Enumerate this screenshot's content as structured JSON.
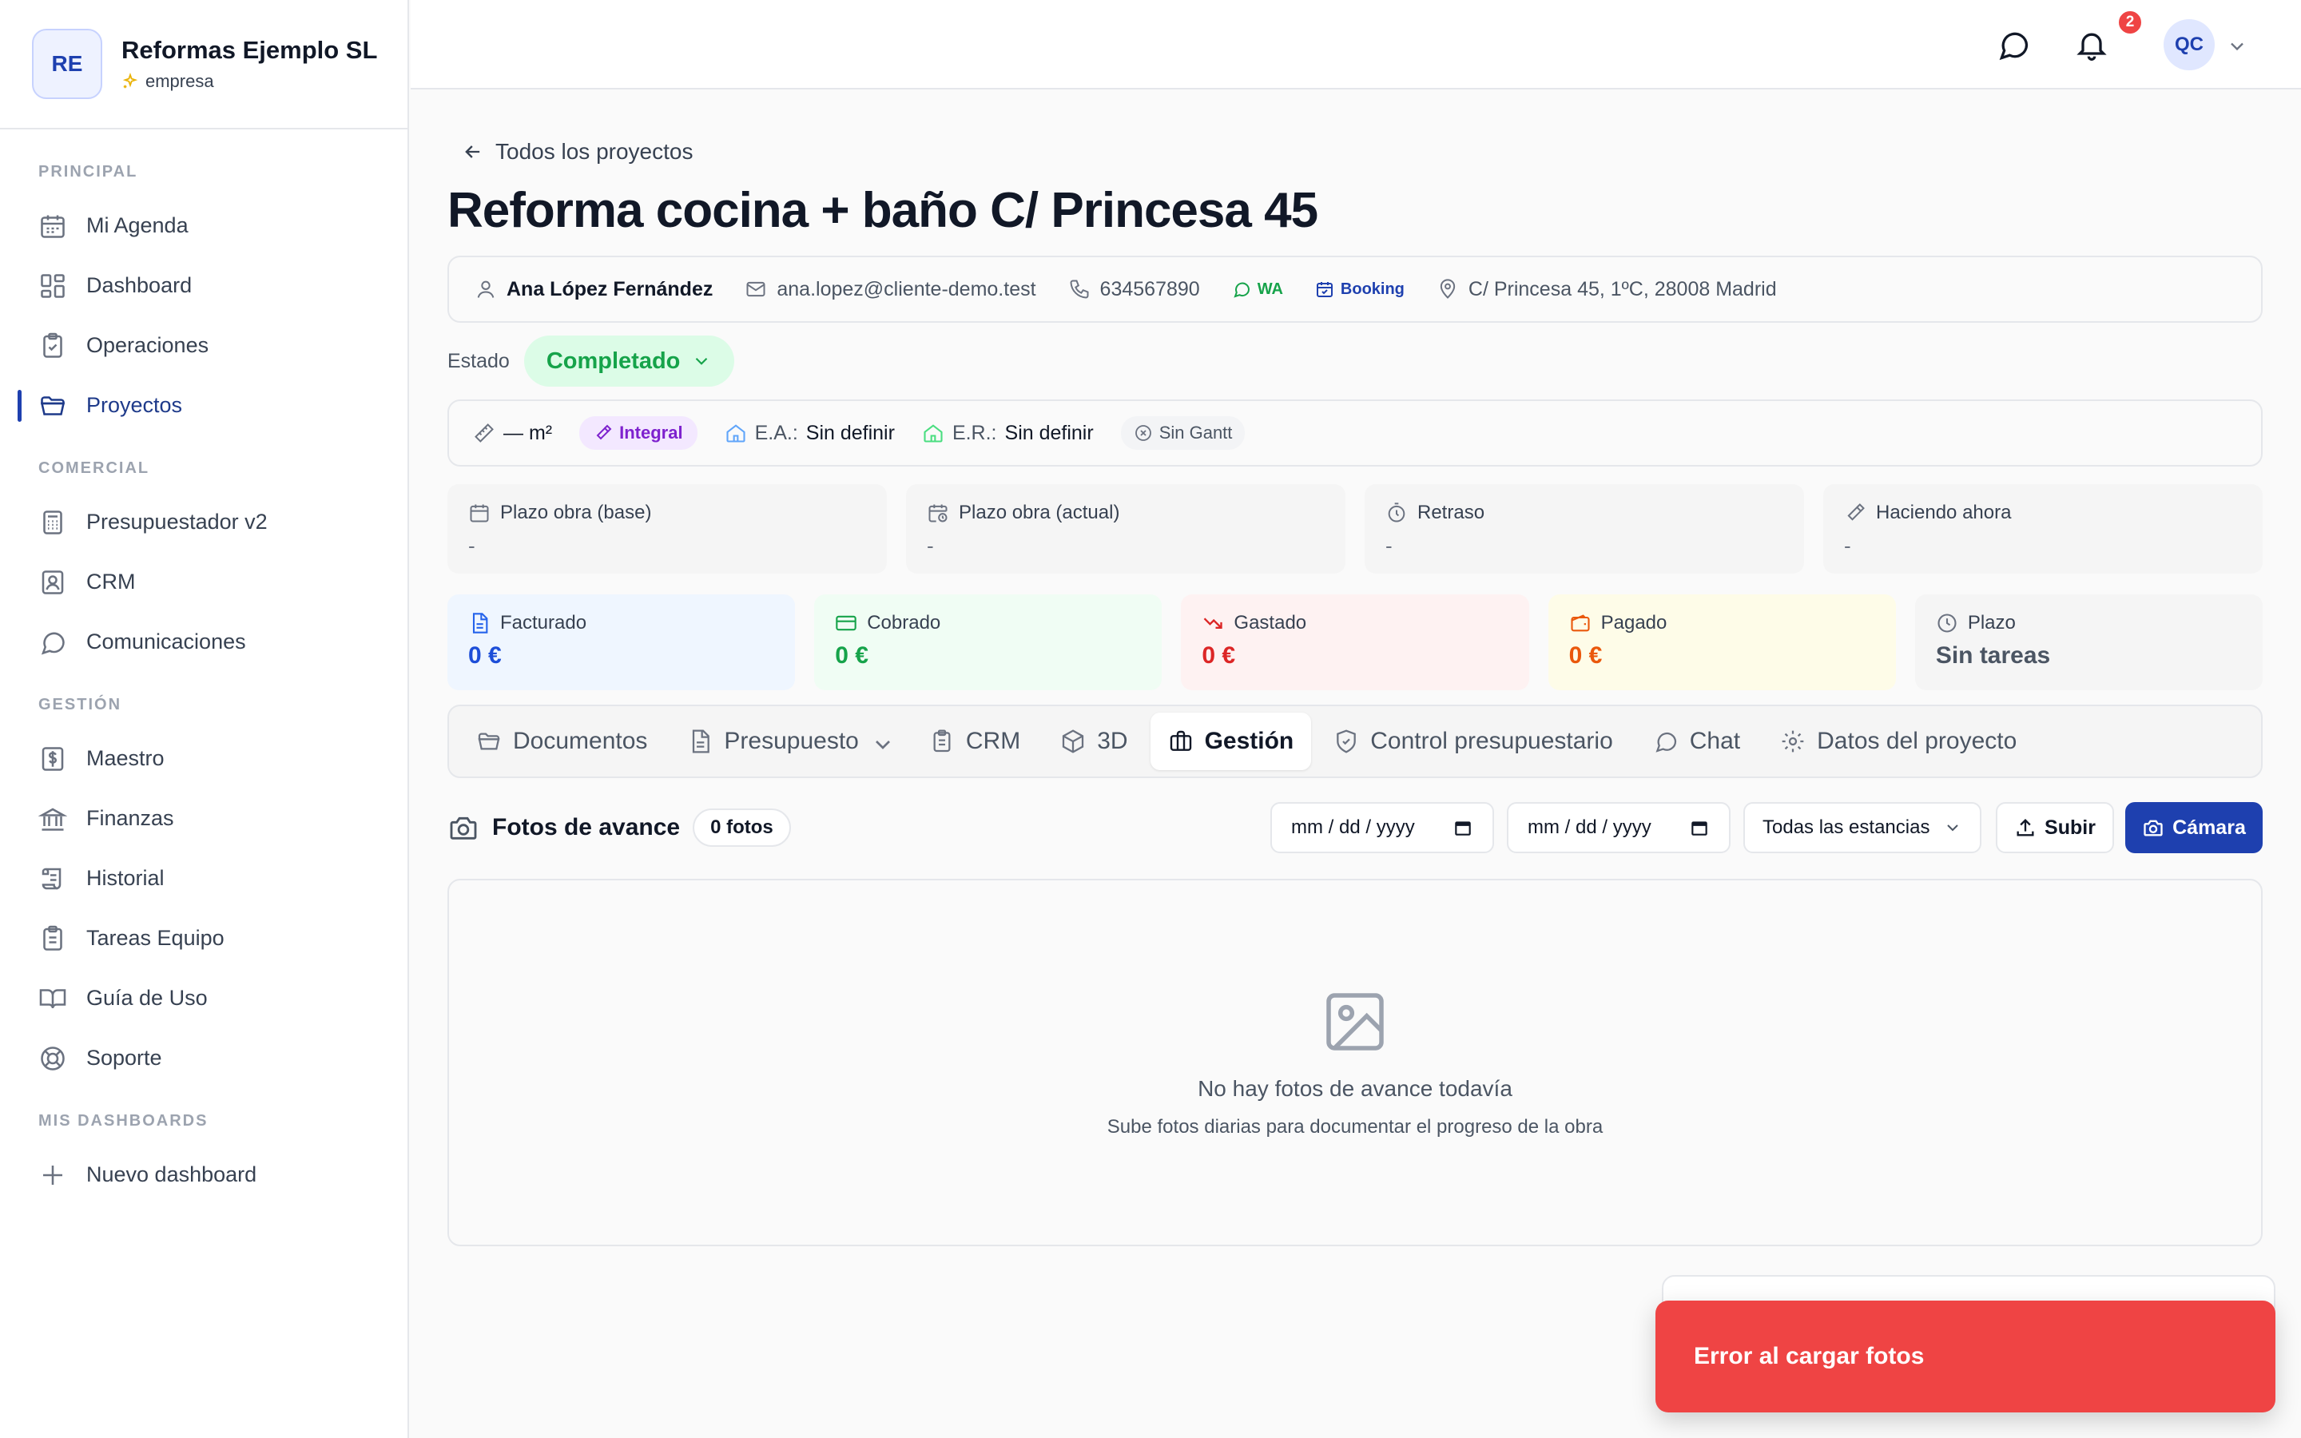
{
  "brand": {
    "initials": "RE",
    "name": "Reformas Ejemplo SL",
    "plan": "empresa"
  },
  "sidebar": {
    "sections": [
      {
        "title": "PRINCIPAL",
        "items": [
          {
            "label": "Mi Agenda",
            "icon": "calendar-icon"
          },
          {
            "label": "Dashboard",
            "icon": "dashboard-icon"
          },
          {
            "label": "Operaciones",
            "icon": "clipboard-icon"
          },
          {
            "label": "Proyectos",
            "icon": "folder-icon",
            "active": true
          }
        ]
      },
      {
        "title": "COMERCIAL",
        "items": [
          {
            "label": "Presupuestador v2",
            "icon": "calculator-icon"
          },
          {
            "label": "CRM",
            "icon": "contact-icon"
          },
          {
            "label": "Comunicaciones",
            "icon": "chat-icon"
          }
        ]
      },
      {
        "title": "GESTIÓN",
        "items": [
          {
            "label": "Maestro",
            "icon": "dollar-icon"
          },
          {
            "label": "Finanzas",
            "icon": "bank-icon"
          },
          {
            "label": "Historial",
            "icon": "scroll-icon"
          },
          {
            "label": "Tareas Equipo",
            "icon": "clipboard-list-icon"
          },
          {
            "label": "Guía de Uso",
            "icon": "book-icon"
          },
          {
            "label": "Soporte",
            "icon": "lifebuoy-icon"
          }
        ]
      },
      {
        "title": "MIS DASHBOARDS",
        "items": [
          {
            "label": "Nuevo dashboard",
            "icon": "plus-icon"
          }
        ]
      }
    ]
  },
  "header": {
    "notifications_count": "2",
    "user_initials": "QC"
  },
  "project": {
    "back_label": "Todos los proyectos",
    "title": "Reforma cocina + baño C/ Princesa 45",
    "client_name": "Ana López Fernández",
    "email": "ana.lopez@cliente-demo.test",
    "phone": "634567890",
    "wa": "WA",
    "booking": "Booking",
    "address": "C/ Princesa 45, 1ºC, 28008 Madrid",
    "estado_label": "Estado",
    "estado_value": "Completado",
    "area": "— m²",
    "type": "Integral",
    "ea_label": "E.A.:",
    "ea_value": "Sin definir",
    "er_label": "E.R.:",
    "er_value": "Sin definir",
    "gantt": "Sin Gantt"
  },
  "plazos": [
    {
      "label": "Plazo obra (base)",
      "value": "-"
    },
    {
      "label": "Plazo obra (actual)",
      "value": "-"
    },
    {
      "label": "Retraso",
      "value": "-"
    },
    {
      "label": "Haciendo ahora",
      "value": "-"
    }
  ],
  "finance": [
    {
      "label": "Facturado",
      "value": "0 €",
      "bg": "#eff6ff",
      "color": "#1d4ed8"
    },
    {
      "label": "Cobrado",
      "value": "0 €",
      "bg": "#f0fdf4",
      "color": "#16a34a"
    },
    {
      "label": "Gastado",
      "value": "0 €",
      "bg": "#fef2f2",
      "color": "#dc2626"
    },
    {
      "label": "Pagado",
      "value": "0 €",
      "bg": "#fefce8",
      "color": "#ea580c"
    },
    {
      "label": "Plazo",
      "value": "Sin tareas",
      "bg": "#f5f5f5",
      "color": "#4b5563"
    }
  ],
  "tabs": [
    {
      "label": "Documentos"
    },
    {
      "label": "Presupuesto"
    },
    {
      "label": "CRM"
    },
    {
      "label": "3D"
    },
    {
      "label": "Gestión",
      "active": true
    },
    {
      "label": "Control presupuestario"
    },
    {
      "label": "Chat"
    },
    {
      "label": "Datos del proyecto"
    }
  ],
  "fotos": {
    "title": "Fotos de avance",
    "count": "0 fotos",
    "date_from": "mm / dd / yyyy",
    "date_to": "mm / dd / yyyy",
    "stance_filter": "Todas las estancias",
    "upload_label": "Subir",
    "camera_label": "Cámara",
    "empty_title": "No hay fotos de avance todavía",
    "empty_subtitle": "Sube fotos diarias para documentar el progreso de la obra"
  },
  "toast": {
    "message": "Error al cargar fotos"
  },
  "colors": {
    "accent": "#1e40af",
    "success": "#16a34a",
    "danger": "#ef4444"
  }
}
